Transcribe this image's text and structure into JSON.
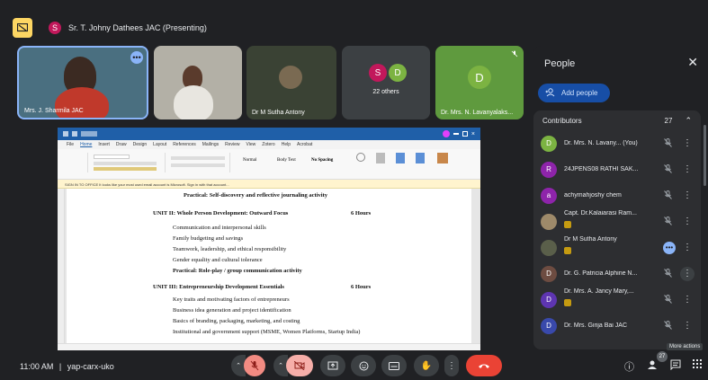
{
  "banner": {
    "presenter_initial": "S",
    "text": "Sr. T. Johny Dathees JAC (Presenting)"
  },
  "tiles": [
    {
      "name": "Mrs. J. Sharmila JAC"
    },
    {
      "name": ""
    },
    {
      "name": "Dr M Sutha Antony"
    },
    {
      "initials": [
        "S",
        "D"
      ],
      "others": "22 others"
    },
    {
      "initial": "D",
      "name": "Dr. Mrs. N. Lavanyalaks..."
    }
  ],
  "screen": {
    "tabs": [
      "File",
      "Home",
      "Insert",
      "Draw",
      "Design",
      "Layout",
      "References",
      "Mailings",
      "Review",
      "View",
      "Zotero",
      "Help",
      "Acrobat"
    ],
    "styles": [
      "Normal",
      "Body Text",
      "No Spacing"
    ],
    "warning": "SIGN IN TO OFFICE  It looks like your most used email account is Microsoft. Sign in with that account...",
    "doc_lines": [
      {
        "text": "Practical: Self-discovery and reflective journaling activity"
      },
      {
        "text": "UNIT II: Whole Person Development: Outward Focus",
        "hours": "6 Hours"
      },
      {
        "text": "Communication and interpersonal skills"
      },
      {
        "text": "Family budgeting and savings"
      },
      {
        "text": "Teamwork, leadership, and ethical responsibility"
      },
      {
        "text": "Gender equality and cultural tolerance"
      },
      {
        "text": "Practical: Role-play / group communication activity"
      },
      {
        "text": "UNIT III: Entrepreneurship Development Essentials",
        "hours": "6 Hours"
      },
      {
        "text": "Key traits and motivating factors of entrepreneurs"
      },
      {
        "text": "Business idea generation and project identification"
      },
      {
        "text": "Basics of branding, packaging, marketing, and costing"
      },
      {
        "text": "Institutional and government support (MSME, Women Platforms, Startup India)"
      }
    ]
  },
  "people_panel": {
    "title": "People",
    "add_people": "Add people",
    "contributors_label": "Contributors",
    "contributors_count": "27",
    "more_actions_tooltip": "More actions",
    "participants": [
      {
        "initial": "D",
        "name": "Dr. Mrs. N. Lavany... (You)",
        "color": "#7cb342"
      },
      {
        "initial": "R",
        "name": "24JPENS08 RATHI SAK...",
        "color": "#8e24aa"
      },
      {
        "initial": "a",
        "name": "achymahjoshy chem",
        "color": "#8e24aa"
      },
      {
        "initial": "",
        "name": "Capt. Dr.Kalaiarasi Ram...",
        "color": "#9e8a6a",
        "badge": true
      },
      {
        "initial": "",
        "name": "Dr M Sutha Antony",
        "color": "#5a5f4a",
        "badge": true,
        "speaking": true
      },
      {
        "initial": "D",
        "name": "Dr. G. Patricia Alphine N...",
        "color": "#6d4c41"
      },
      {
        "initial": "D",
        "name": "Dr. Mrs. A. Jancy Mary,...",
        "color": "#5e35b1",
        "badge": true
      },
      {
        "initial": "D",
        "name": "Dr. Mrs. Girija Bai JAC",
        "color": "#3949ab"
      }
    ]
  },
  "bottom": {
    "time": "11:00 AM",
    "separator": "|",
    "meeting_code": "yap-carx-uko",
    "people_count": "27"
  }
}
